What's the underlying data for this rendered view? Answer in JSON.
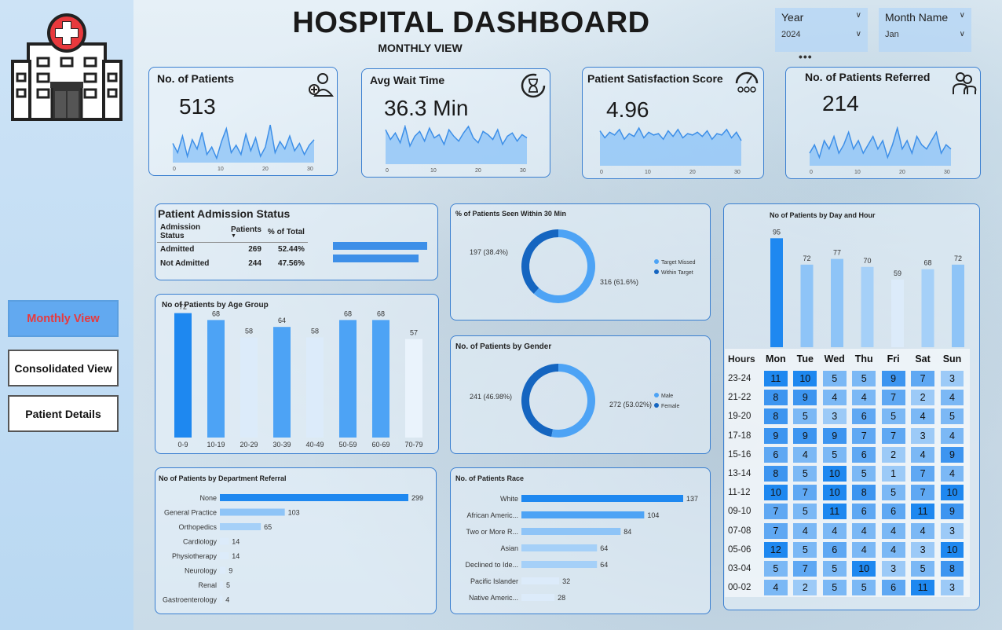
{
  "header": {
    "title": "HOSPITAL DASHBOARD",
    "subtitle": "MONTHLY VIEW",
    "more_glyph": "•••",
    "year": {
      "label": "Year",
      "value": "2024"
    },
    "month": {
      "label": "Month Name",
      "value": "Jan"
    }
  },
  "nav": {
    "monthly": "Monthly View",
    "consolidated": "Consolidated View",
    "details": "Patient Details"
  },
  "kpis": [
    {
      "title": "No. of Patients",
      "value": "513",
      "icon": "patient-add-icon",
      "ticks": [
        "0",
        "10",
        "20",
        "30"
      ],
      "spark": [
        14,
        9,
        18,
        7,
        16,
        11,
        20,
        8,
        12,
        6,
        15,
        22,
        9,
        13,
        8,
        19,
        10,
        17,
        7,
        12,
        24,
        9,
        15,
        11,
        18,
        10,
        14,
        8,
        13,
        16
      ]
    },
    {
      "title": "Avg Wait Time",
      "value": "36.3 Min",
      "icon": "hourglass-icon",
      "ticks": [
        "0",
        "10",
        "20",
        "30"
      ],
      "spark": [
        38,
        32,
        36,
        30,
        40,
        28,
        34,
        37,
        31,
        39,
        33,
        35,
        29,
        38,
        34,
        31,
        36,
        40,
        33,
        30,
        37,
        35,
        32,
        38,
        29,
        34,
        36,
        31,
        35,
        33
      ]
    },
    {
      "title": "Patient Satisfaction Score",
      "value": "4.96",
      "icon": "gauge-icon",
      "ticks": [
        "0",
        "10",
        "20",
        "30"
      ],
      "spark": [
        5.2,
        4.7,
        5.1,
        4.9,
        5.3,
        4.6,
        5.0,
        4.8,
        5.4,
        4.7,
        5.1,
        4.9,
        5.0,
        4.6,
        5.2,
        4.8,
        5.3,
        4.7,
        5.0,
        4.9,
        5.1,
        4.8,
        5.2,
        4.6,
        5.0,
        4.9,
        5.3,
        4.7,
        5.1,
        4.5
      ]
    },
    {
      "title": "No. of Patients Referred",
      "value": "214",
      "icon": "doctors-icon",
      "ticks": [
        "0",
        "10",
        "20",
        "30"
      ],
      "spark": [
        6,
        8,
        5,
        9,
        7,
        10,
        6,
        8,
        11,
        7,
        9,
        6,
        8,
        10,
        7,
        9,
        5,
        8,
        12,
        7,
        9,
        6,
        10,
        8,
        7,
        9,
        11,
        6,
        8,
        7
      ]
    }
  ],
  "admission": {
    "title": "Patient Admission Status",
    "headers": [
      "Admission Status",
      "Patients",
      "% of Total"
    ],
    "rows": [
      {
        "status": "Admitted",
        "patients": 269,
        "pct": "52.44%"
      },
      {
        "status": "Not Admitted",
        "patients": 244,
        "pct": "47.56%"
      }
    ]
  },
  "seen30": {
    "title": "% of Patients Seen Within 30 Min",
    "slices": [
      {
        "name": "Target Missed",
        "label": "316 (61.6%)",
        "value": 316,
        "color": "#4da3f5"
      },
      {
        "name": "Within Target",
        "label": "197 (38.4%)",
        "value": 197,
        "color": "#1565c0"
      }
    ]
  },
  "gender": {
    "title": "No. of Patients by Gender",
    "slices": [
      {
        "name": "Male",
        "label": "272 (53.02%)",
        "value": 272,
        "color": "#4da3f5"
      },
      {
        "name": "Female",
        "label": "241 (46.98%)",
        "value": 241,
        "color": "#1565c0"
      }
    ]
  },
  "chart_data": [
    {
      "type": "bar",
      "title": "No of Patients by Age Group",
      "categories": [
        "0-9",
        "10-19",
        "20-29",
        "30-39",
        "40-49",
        "50-59",
        "60-69",
        "70-79"
      ],
      "values": [
        72,
        68,
        58,
        64,
        58,
        68,
        68,
        57
      ],
      "ylim": [
        0,
        80
      ]
    },
    {
      "type": "bar",
      "title": "No of Patients by Day and Hour",
      "categories": [
        "Mon",
        "Tue",
        "Wed",
        "Thu",
        "Fri",
        "Sat",
        "Sun"
      ],
      "values": [
        95,
        72,
        77,
        70,
        59,
        68,
        72
      ],
      "ylim": [
        0,
        100
      ]
    },
    {
      "type": "bar",
      "orientation": "horizontal",
      "title": "No of Patients by Department Referral",
      "categories": [
        "None",
        "General Practice",
        "Orthopedics",
        "Cardiology",
        "Physiotherapy",
        "Neurology",
        "Renal",
        "Gastroenterology"
      ],
      "values": [
        299,
        103,
        65,
        14,
        14,
        9,
        5,
        4
      ]
    },
    {
      "type": "bar",
      "orientation": "horizontal",
      "title": "No. of Patients Race",
      "categories": [
        "White",
        "African Americ...",
        "Two or More R...",
        "Asian",
        "Declined to Ide...",
        "Pacific Islander",
        "Native Americ..."
      ],
      "values": [
        137,
        104,
        84,
        64,
        64,
        32,
        28
      ]
    },
    {
      "type": "heatmap",
      "xlabel": "Hours",
      "columns": [
        "Mon",
        "Tue",
        "Wed",
        "Thu",
        "Fri",
        "Sat",
        "Sun"
      ],
      "rows": [
        "23-24",
        "21-22",
        "19-20",
        "17-18",
        "15-16",
        "13-14",
        "11-12",
        "09-10",
        "07-08",
        "05-06",
        "03-04",
        "00-02"
      ],
      "values": [
        [
          11,
          10,
          5,
          5,
          9,
          7,
          3
        ],
        [
          8,
          9,
          4,
          4,
          7,
          2,
          4
        ],
        [
          8,
          5,
          3,
          6,
          5,
          4,
          5
        ],
        [
          9,
          9,
          9,
          7,
          7,
          3,
          4
        ],
        [
          6,
          4,
          5,
          6,
          2,
          4,
          9
        ],
        [
          8,
          5,
          10,
          5,
          1,
          7,
          4
        ],
        [
          10,
          7,
          10,
          8,
          5,
          7,
          10
        ],
        [
          7,
          5,
          11,
          6,
          6,
          11,
          9
        ],
        [
          7,
          4,
          4,
          4,
          4,
          4,
          3
        ],
        [
          12,
          5,
          6,
          4,
          4,
          3,
          10
        ],
        [
          5,
          7,
          5,
          10,
          3,
          5,
          8
        ],
        [
          4,
          2,
          5,
          5,
          6,
          11,
          3
        ]
      ]
    }
  ]
}
